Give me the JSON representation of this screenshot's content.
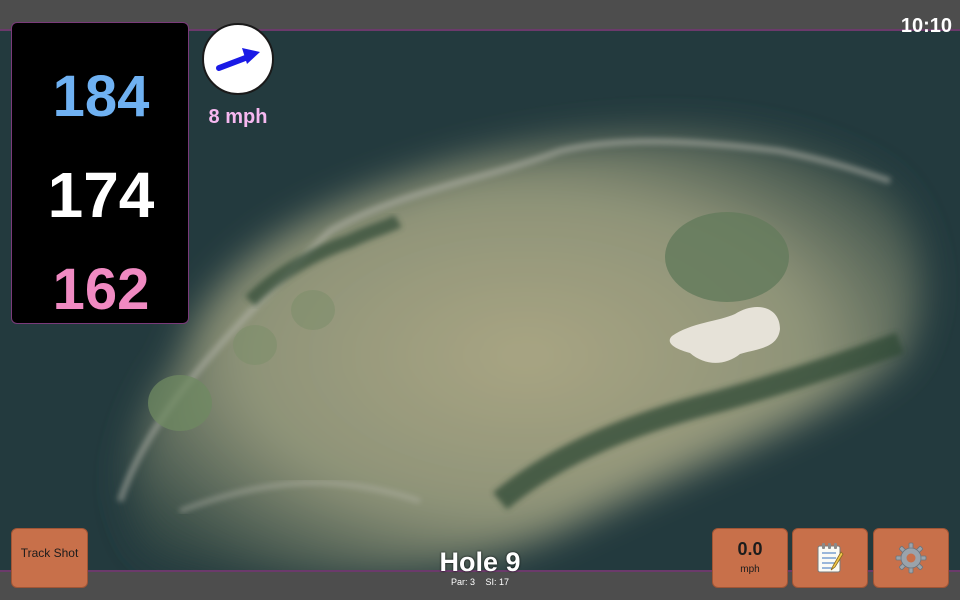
{
  "status_bar": {
    "time": "10:10"
  },
  "distances": {
    "back": "184",
    "middle": "174",
    "front": "162"
  },
  "wind": {
    "speed_label": "8 mph",
    "direction_icon": "wind-arrow-icon",
    "arrow_color": "#1a1ae6"
  },
  "hole": {
    "title": "Hole 9",
    "par": "Par: 3",
    "stroke_index": "SI: 17"
  },
  "buttons": {
    "track_shot": "Track Shot",
    "speed_value": "0.0",
    "speed_unit": "mph",
    "notes_icon": "notepad-icon",
    "settings_icon": "gear-icon"
  },
  "colors": {
    "back_tee": "#6fb1f2",
    "middle": "#ffffff",
    "front": "#f08ac2",
    "button": "#c8704a",
    "wind_label": "#f6b8f0"
  }
}
